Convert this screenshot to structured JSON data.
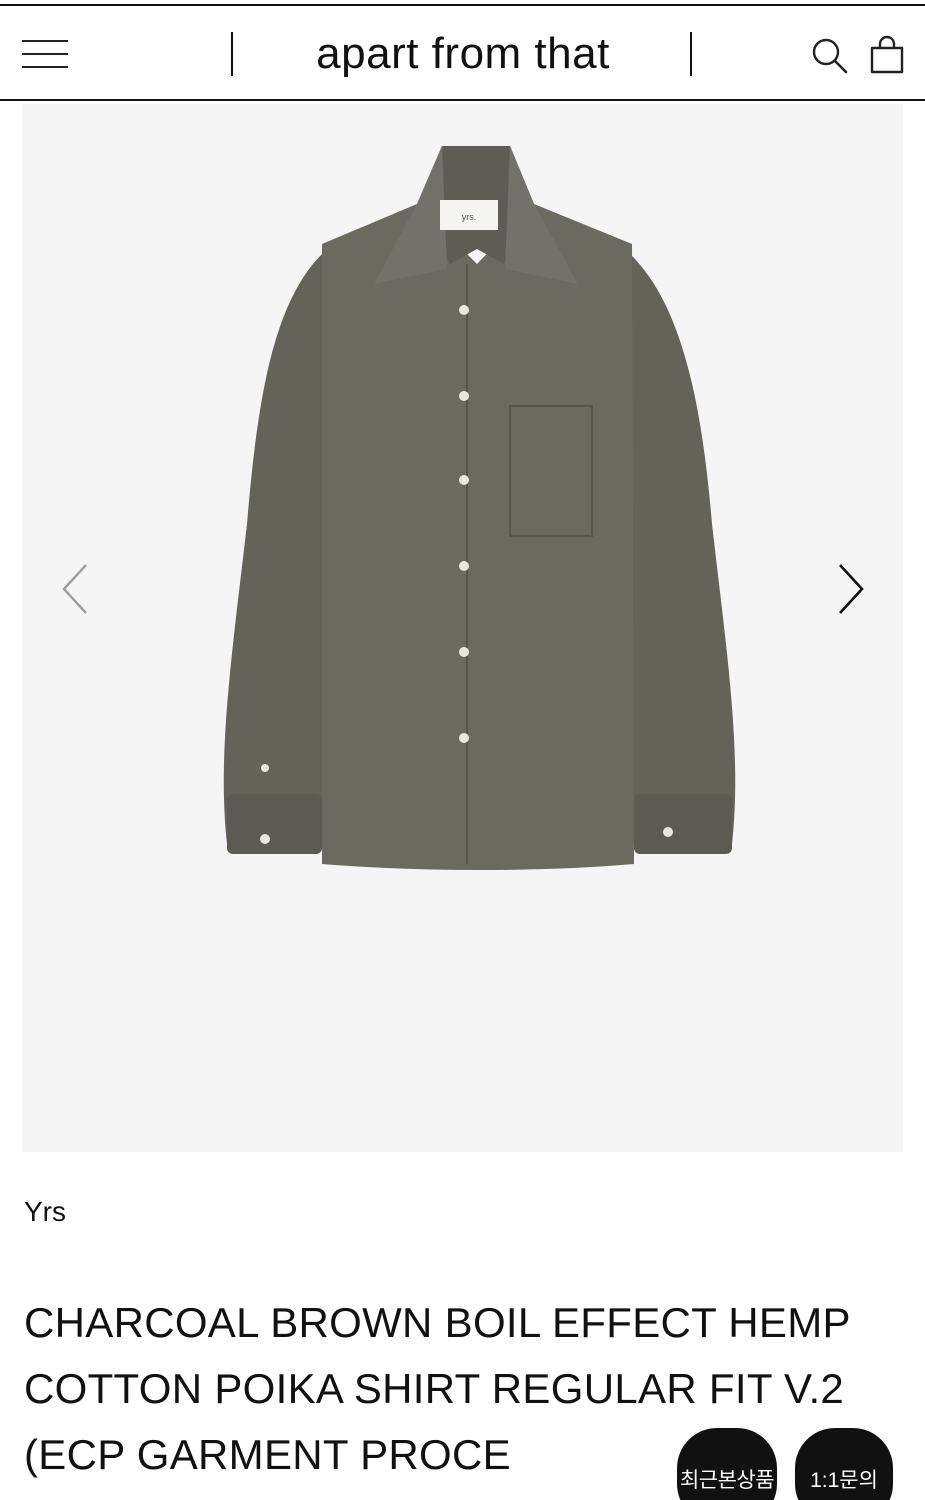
{
  "header": {
    "brand": "apart from that",
    "icons": [
      "menu-icon",
      "search-icon",
      "bag-icon"
    ]
  },
  "gallery": {
    "image": "product-shirt-image",
    "shirt_label": "yrs.",
    "prev_icon": "chevron-left-icon",
    "next_icon": "chevron-right-icon"
  },
  "product": {
    "brand": "Yrs",
    "title": "CHARCOAL BROWN BOIL EFFECT HEMP COTTON POIKA SHIRT REGULAR FIT V.2 (ECP GARMENT PROCE"
  },
  "floating": {
    "recent_label": "최근본상품",
    "qna_label": "1:1문의"
  },
  "colors": {
    "text": "#111111",
    "gallery_bg": "#f5f5f5",
    "shirt": "#6b6a61",
    "button_bg": "#111111"
  }
}
